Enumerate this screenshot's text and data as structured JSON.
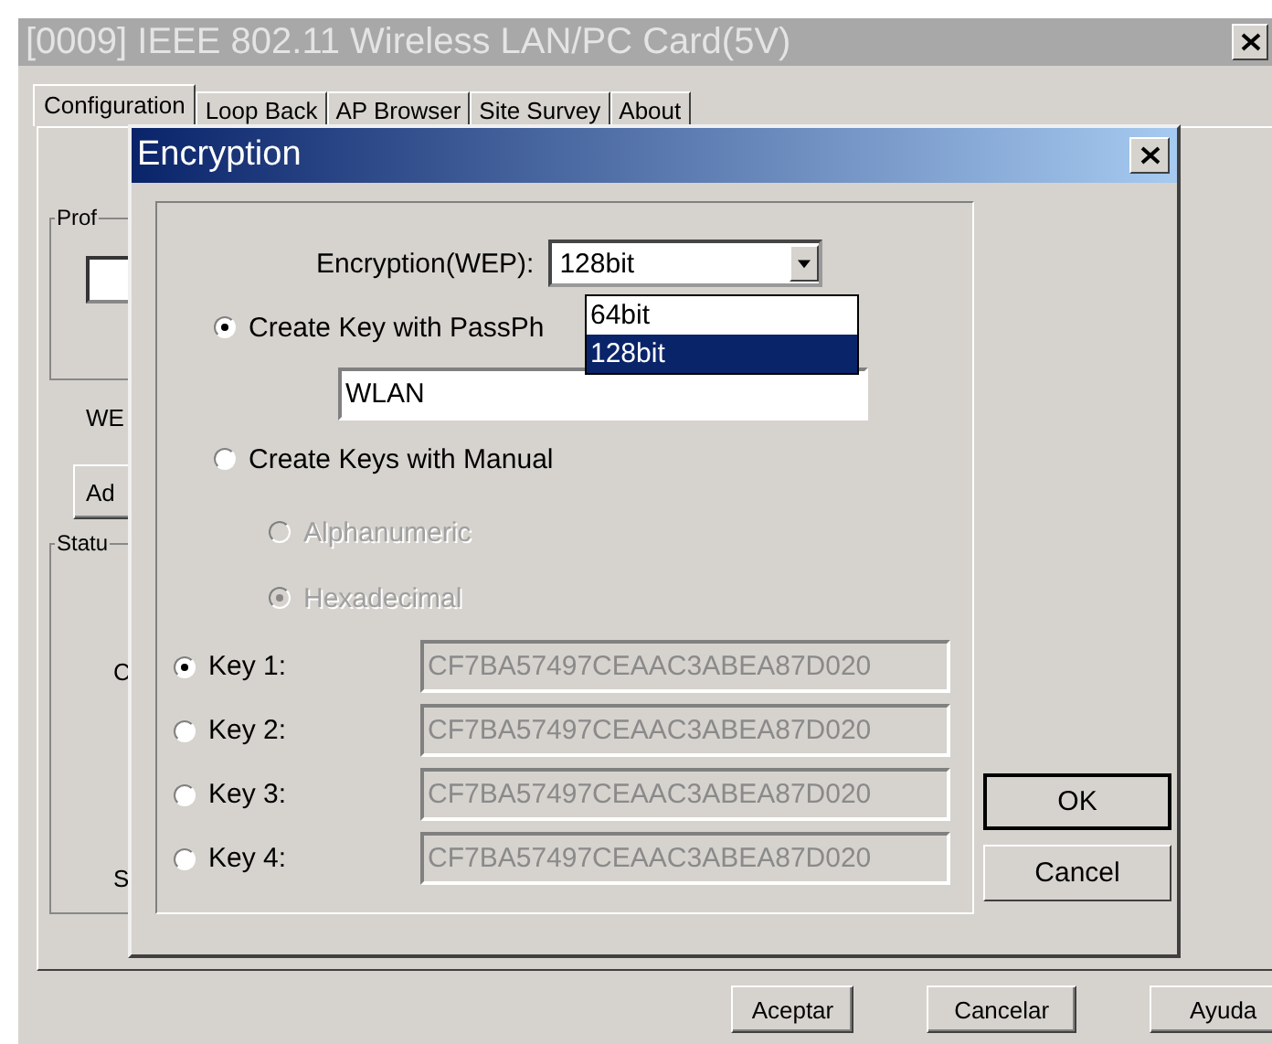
{
  "main_window": {
    "title": "[0009] IEEE 802.11 Wireless LAN/PC Card(5V)",
    "tabs": [
      {
        "label": "Configuration",
        "selected": true
      },
      {
        "label": "Loop Back",
        "selected": false
      },
      {
        "label": "AP Browser",
        "selected": false
      },
      {
        "label": "Site Survey",
        "selected": false
      },
      {
        "label": "About",
        "selected": false
      }
    ],
    "profile_group_label": "Prof",
    "wep_label": "WE",
    "add_button": "Ad",
    "status_group_label": "Statu",
    "status_letters": [
      "C",
      "S"
    ],
    "buttons": [
      "Aceptar",
      "Cancelar",
      "Ayuda"
    ]
  },
  "dialog": {
    "title": "Encryption",
    "encryption_label": "Encryption(WEP):",
    "encryption_value": "128bit",
    "dropdown_options": [
      {
        "label": "64bit",
        "selected": false
      },
      {
        "label": "128bit",
        "selected": true
      }
    ],
    "passphrase_radio": {
      "label": "Create Key with PassPh",
      "selected": true
    },
    "passphrase_value": "WLAN",
    "manual_radio": {
      "label": "Create Keys with Manual",
      "selected": false
    },
    "format_options": [
      {
        "label": "Alphanumeric",
        "selected": false,
        "disabled": true
      },
      {
        "label": "Hexadecimal",
        "selected": true,
        "disabled": true
      }
    ],
    "keys": [
      {
        "label": "Key 1:",
        "selected": true,
        "value": "CF7BA57497CEAAC3ABEA87D020"
      },
      {
        "label": "Key 2:",
        "selected": false,
        "value": "CF7BA57497CEAAC3ABEA87D020"
      },
      {
        "label": "Key 3:",
        "selected": false,
        "value": "CF7BA57497CEAAC3ABEA87D020"
      },
      {
        "label": "Key 4:",
        "selected": false,
        "value": "CF7BA57497CEAAC3ABEA87D020"
      }
    ],
    "buttons": [
      {
        "label": "OK",
        "default": true
      },
      {
        "label": "Cancel",
        "default": false
      }
    ]
  }
}
